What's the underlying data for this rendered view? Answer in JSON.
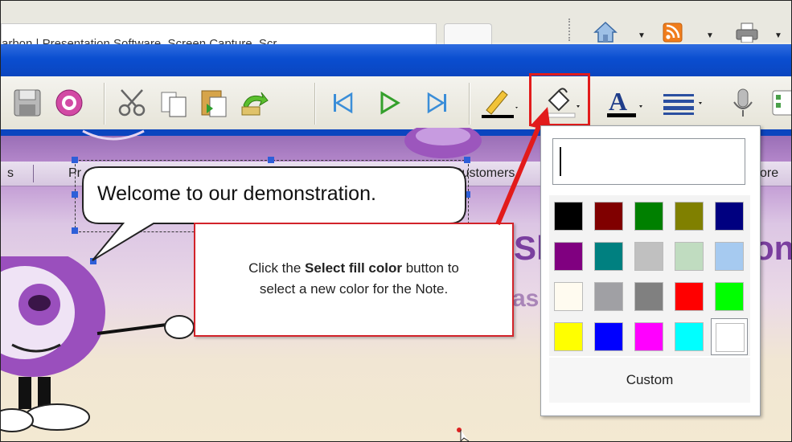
{
  "browser": {
    "tab_title": "arbon | Presentation Software, Screen Capture, Scr",
    "icons": [
      "home-icon",
      "rss-feed-icon",
      "print-icon"
    ]
  },
  "toolbar": {
    "tools": [
      "save-icon",
      "record-icon",
      "cut-icon",
      "copy-icon",
      "paste-icon",
      "undo-icon",
      "first-slide-icon",
      "play-icon",
      "last-slide-icon",
      "line-color-icon",
      "fill-color-icon",
      "font-color-icon",
      "line-style-icon",
      "microphone-icon",
      "layout-icon"
    ]
  },
  "website": {
    "nav_items": [
      "s",
      "Pr",
      "Customers",
      "ore"
    ],
    "heading_fragment": "Sh",
    "heading_fragment_right": "on",
    "subheading_fragment": "as"
  },
  "note": {
    "text": "Welcome to our demonstration."
  },
  "callout": {
    "prefix": "Click the ",
    "bold": "Select fill color",
    "suffix": " button to",
    "line2": "select a new color for the Note.",
    "border_color": "#d2232a"
  },
  "color_popup": {
    "input_value": "",
    "swatches": [
      "#000000",
      "#800000",
      "#008000",
      "#808000",
      "#000080",
      "#800080",
      "#008080",
      "#c0c0c0",
      "#c0dcc0",
      "#a6caf0",
      "#fffbf0",
      "#a0a0a4",
      "#808080",
      "#ff0000",
      "#00ff00",
      "#ffff00",
      "#0000ff",
      "#ff00ff",
      "#00ffff",
      "#ffffff"
    ],
    "custom_label": "Custom"
  },
  "accent": {
    "title_bar": "#0b45bf",
    "highlight": "#e21b1b"
  }
}
